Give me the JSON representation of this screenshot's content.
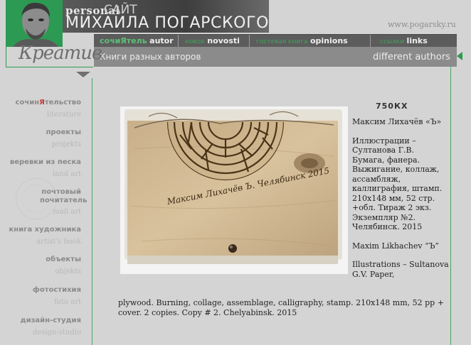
{
  "header": {
    "personal": "personal",
    "sait": "САЙТ",
    "name": "МИХАИЛА ПОГАРСКОГО",
    "url": "www.pogarsky.ru",
    "signature": "Креатив"
  },
  "nav": [
    {
      "ru": "сочиЯтель",
      "en": "autor"
    },
    {
      "ru": "новое",
      "en": "novosti"
    },
    {
      "ru": "гостевая книга",
      "en": "opinions"
    },
    {
      "ru": "ссылки",
      "en": "links"
    }
  ],
  "section": {
    "title_ru": "Книги разных авторов",
    "title_en": "different authors"
  },
  "sidebar": [
    {
      "ru": "сочиЯтельство",
      "en": "literature"
    },
    {
      "ru": "проекты",
      "en": "projekts"
    },
    {
      "ru": "веревки из песка",
      "en": "land art"
    },
    {
      "ru": "почтовый почитатель",
      "en": "mail art"
    },
    {
      "ru": "книга художника",
      "en": "artist's book"
    },
    {
      "ru": "объекты",
      "en": "objekts"
    },
    {
      "ru": "фотостихия",
      "en": "foto art"
    },
    {
      "ru": "дизайн-студия",
      "en": "design-studio"
    }
  ],
  "book": {
    "code": "750КХ",
    "author_ru": "Максим Лихачёв «Ъ»",
    "desc_ru": "Иллюстрации – Султанова Г.В. Бумага, фанера. Выжигание, коллаж, ассамбляж, каллиграфия, штамп. 210х148 мм, 52 стр. +обл. Тираж 2 экз. Экземпляр №2. Челябинск. 2015",
    "author_en": "Maxim Likhachev “Ъ”",
    "desc_en_start": "Illustrations – Sultanova G.V. Paper,",
    "desc_en_end": "plywood. Burning, collage, assemblage, calligraphy, stamp. 210x148 mm, 52 pp + cover. 2 copies. Copy # 2. Chelyabinsk. 2015",
    "burned_text": "Максим Лихачёв   Ъ. Челябинск 2015"
  },
  "colors": {
    "accent": "#2d9a53",
    "nav_bg": "#5c5c5c",
    "bar_bg": "#8b8b8b",
    "page_bg": "#d4d4d4"
  }
}
